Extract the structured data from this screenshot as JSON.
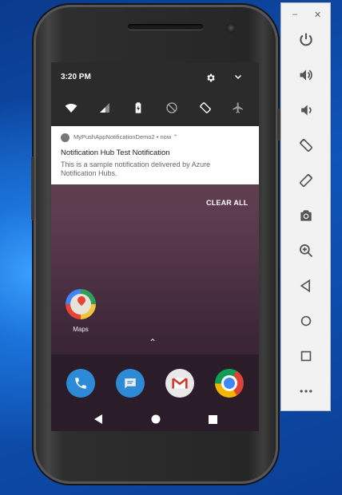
{
  "status_bar": {
    "time": "3:20 PM"
  },
  "notification": {
    "app_line": "MyPushAppNotificationDemo2 • now ⌃",
    "title": "Notification Hub Test Notification",
    "body": "This is a sample notification delivered by Azure Notification Hubs."
  },
  "shade": {
    "clear_all": "CLEAR ALL"
  },
  "home": {
    "app_label": "Maps",
    "dock": [
      "phone-icon",
      "messages-icon",
      "gmail-icon",
      "chrome-icon"
    ]
  },
  "window_controls": {
    "minimize": "–",
    "close": "✕"
  },
  "toolbar_buttons": [
    "power-icon",
    "volume-up-icon",
    "volume-down-icon",
    "rotate-left-icon",
    "rotate-right-icon",
    "camera-icon",
    "zoom-icon",
    "back-icon",
    "home-icon",
    "overview-icon",
    "more-icon"
  ],
  "colors": {
    "toolbar_icon": "#555555",
    "desktop": "#0e55b9",
    "shade": "#2b2b2b"
  }
}
